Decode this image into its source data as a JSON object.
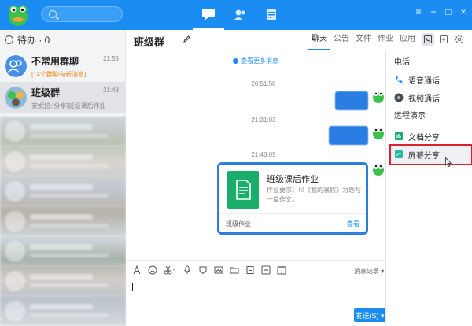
{
  "colors": {
    "brand": "#1a8cf2",
    "highlight": "#d8232a",
    "card_border": "#2d7de0",
    "doc_icon": "#1aad6b"
  },
  "topbar": {
    "nav_icons": [
      "chat-icon",
      "contacts-icon",
      "apps-icon"
    ],
    "window_controls": [
      "≡",
      "−",
      "□",
      "×"
    ]
  },
  "sidebar": {
    "todo_label": "待办 · 0",
    "conversations": [
      {
        "name": "不常用群聊",
        "subtitle": "[14个群聊有新消息]",
        "time": "21:55"
      },
      {
        "name": "班级群",
        "subtitle": "安妮拉:[分享]班级课后作业",
        "time": "21:48"
      }
    ]
  },
  "chat": {
    "title": "班级群",
    "tabs": [
      "聊天",
      "公告",
      "文件",
      "作业",
      "应用"
    ],
    "load_more": "查看更多消息",
    "timestamps": [
      "20:51:58",
      "21:31:03",
      "21:48:09"
    ],
    "card": {
      "title": "班级课后作业",
      "description": "作业要求：以《我的暑假》为题写一篇作文。",
      "footer_left": "班级作业",
      "footer_right": "查看"
    }
  },
  "menu": {
    "section_phone": "电话",
    "voice_call": "语音通话",
    "video_call": "视频通话",
    "section_remote": "远程演示",
    "doc_share": "文档分享",
    "screen_share": "屏幕分享"
  },
  "composer": {
    "history_label": "消息记录 ▾",
    "send_label": "发送(S) ▾"
  }
}
